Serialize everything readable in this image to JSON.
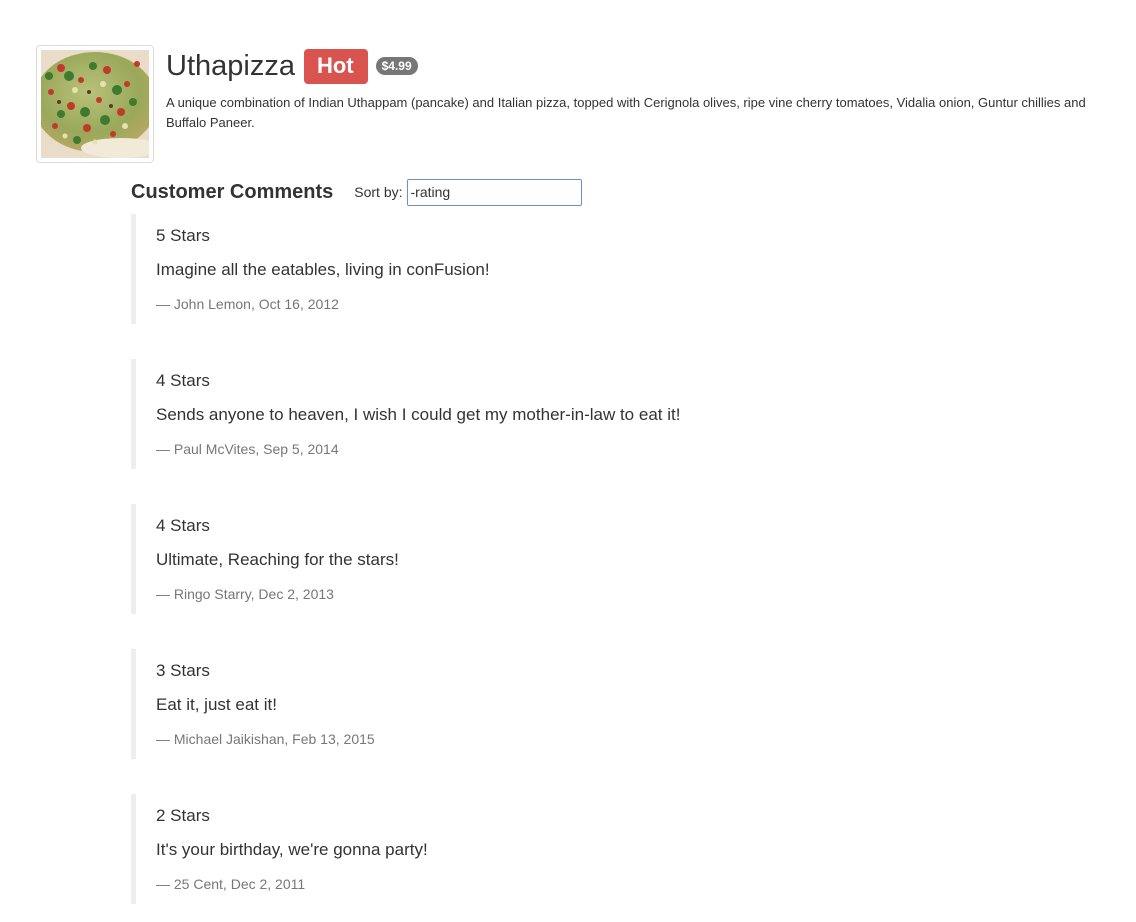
{
  "dish": {
    "image_icon": "pizza-photo",
    "name": "Uthapizza",
    "label": "Hot",
    "price": "$4.99",
    "description": "A unique combination of Indian Uthappam (pancake) and Italian pizza, topped with Cerignola olives, ripe vine cherry tomatoes, Vidalia onion, Guntur chillies and Buffalo Paneer."
  },
  "comments_section": {
    "title": "Customer Comments",
    "sort_label": "Sort by:",
    "sort_value": "-rating"
  },
  "comments": [
    {
      "rating": "5 Stars",
      "text": "Imagine all the eatables, living in conFusion!",
      "footer": "— John Lemon, Oct 16, 2012"
    },
    {
      "rating": "4 Stars",
      "text": "Sends anyone to heaven, I wish I could get my mother-in-law to eat it!",
      "footer": "— Paul McVites, Sep 5, 2014"
    },
    {
      "rating": "4 Stars",
      "text": "Ultimate, Reaching for the stars!",
      "footer": "— Ringo Starry, Dec 2, 2013"
    },
    {
      "rating": "3 Stars",
      "text": "Eat it, just eat it!",
      "footer": "— Michael Jaikishan, Feb 13, 2015"
    },
    {
      "rating": "2 Stars",
      "text": "It's your birthday, we're gonna party!",
      "footer": "— 25 Cent, Dec 2, 2011"
    }
  ],
  "colors": {
    "label_hot": "#d9534f",
    "badge": "#777777",
    "muted_text": "#777777",
    "comment_border": "#eeeeee",
    "input_border": "#6a8fd8"
  }
}
